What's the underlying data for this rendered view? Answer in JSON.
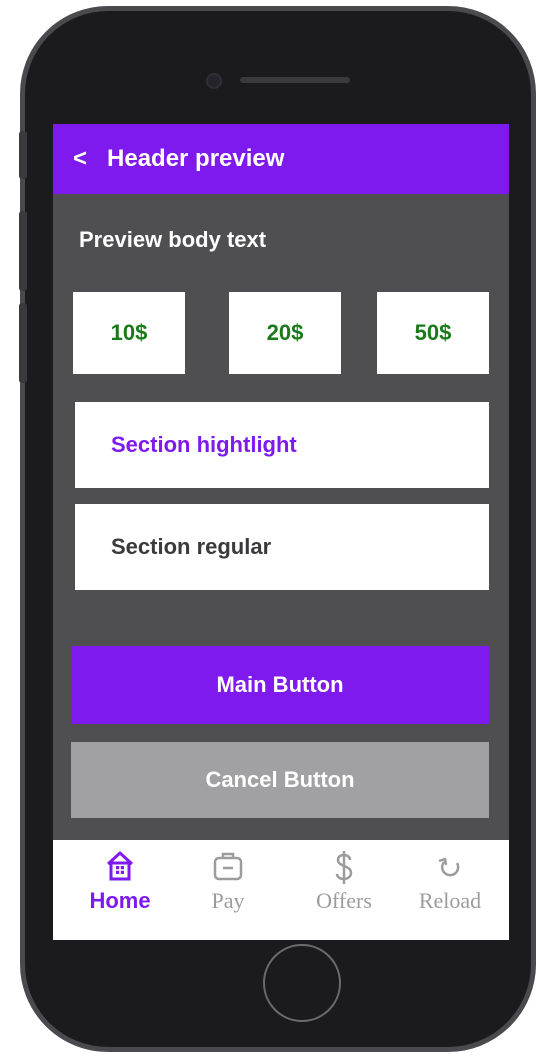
{
  "header": {
    "back_label": "<",
    "title": "Header preview"
  },
  "body": {
    "preview_text": "Preview body text"
  },
  "amounts": [
    "10$",
    "20$",
    "50$"
  ],
  "sections": {
    "highlight_label": "Section hightlight",
    "regular_label": "Section regular"
  },
  "buttons": {
    "main_label": "Main Button",
    "cancel_label": "Cancel Button"
  },
  "tabbar": {
    "items": [
      {
        "label": "Home",
        "icon": "home-icon",
        "active": true
      },
      {
        "label": "Pay",
        "icon": "wallet-icon",
        "active": false
      },
      {
        "label": "Offers",
        "icon": "dollar-icon",
        "active": false
      },
      {
        "label": "Reload",
        "icon": "reload-icon",
        "active": false
      }
    ]
  },
  "colors": {
    "accent": "#7f1aee",
    "screen_background": "#4f4f51",
    "amount_text": "#1a7a1a",
    "cancel_button": "#a1a1a3",
    "inactive_tab": "#9c9c9e"
  }
}
